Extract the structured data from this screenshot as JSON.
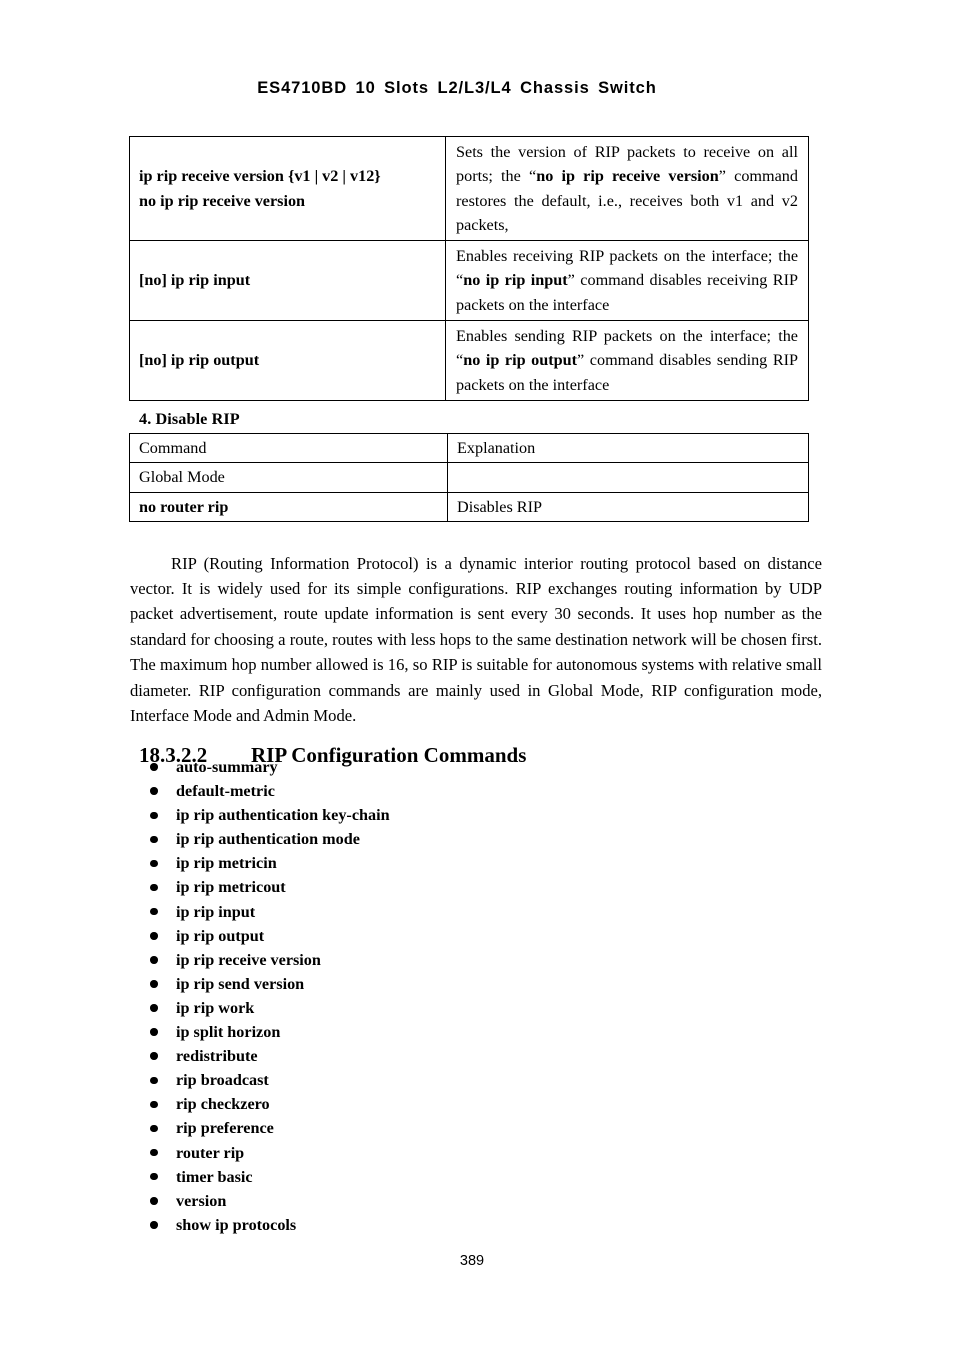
{
  "header": {
    "running_title": "ES4710BD 10 Slots L2/L3/L4 Chassis Switch"
  },
  "command_table": {
    "rows": [
      {
        "command_lines": [
          "ip rip receive version {v1 | v2 | v12}",
          "no ip rip receive version"
        ],
        "explanation_parts": [
          {
            "text": "Sets the version of RIP packets to receive on all ports; the “",
            "bold": false
          },
          {
            "text": "no ip rip receive version",
            "bold": true
          },
          {
            "text": "” command restores the default, i.e., receives both v1 and v2 packets,",
            "bold": false
          }
        ]
      },
      {
        "command_lines": [
          "[no] ip rip input"
        ],
        "explanation_parts": [
          {
            "text": "Enables receiving RIP packets on the interface; the “",
            "bold": false
          },
          {
            "text": "no ip rip input",
            "bold": true
          },
          {
            "text": "” command disables receiving RIP packets on the interface",
            "bold": false
          }
        ]
      },
      {
        "command_lines": [
          "[no] ip rip output"
        ],
        "explanation_parts": [
          {
            "text": "Enables sending RIP packets on the interface; the “",
            "bold": false
          },
          {
            "text": "no ip rip output",
            "bold": true
          },
          {
            "text": "” command disables sending RIP packets on the interface",
            "bold": false
          }
        ]
      }
    ]
  },
  "disable_section": {
    "heading": "4. Disable RIP",
    "table": {
      "header": {
        "command": "Command",
        "explanation": "Explanation"
      },
      "rows": [
        {
          "command": "Global Mode",
          "explanation": "",
          "bold": false
        },
        {
          "command": "no router rip",
          "explanation": "Disables RIP",
          "bold": true
        }
      ]
    }
  },
  "paragraph": {
    "text": "RIP (Routing Information Protocol) is a dynamic interior routing protocol based on distance vector. It is widely used for its simple configurations. RIP exchanges routing information by UDP packet advertisement, route update information is sent every 30 seconds. It uses hop number as the standard for choosing a route, routes with less hops to the same destination network will be chosen first. The maximum hop number allowed is 16, so RIP is suitable for autonomous systems with relative small diameter. RIP configuration commands are mainly used in Global Mode, RIP configuration mode, Interface Mode and Admin Mode."
  },
  "section": {
    "number": "18.3.2.2",
    "title": "RIP Configuration Commands",
    "commands": [
      "auto-summary",
      "default-metric",
      "ip rip authentication key-chain",
      "ip rip authentication mode",
      "ip rip metricin",
      "ip rip metricout",
      "ip rip input",
      "ip rip output",
      "ip rip receive version",
      "ip rip send version",
      "ip rip work",
      "ip split horizon",
      "redistribute",
      "rip broadcast",
      "rip checkzero",
      "rip preference",
      "router rip",
      "timer basic",
      "version",
      "show ip protocols"
    ]
  },
  "footer": {
    "page_number": "389"
  }
}
